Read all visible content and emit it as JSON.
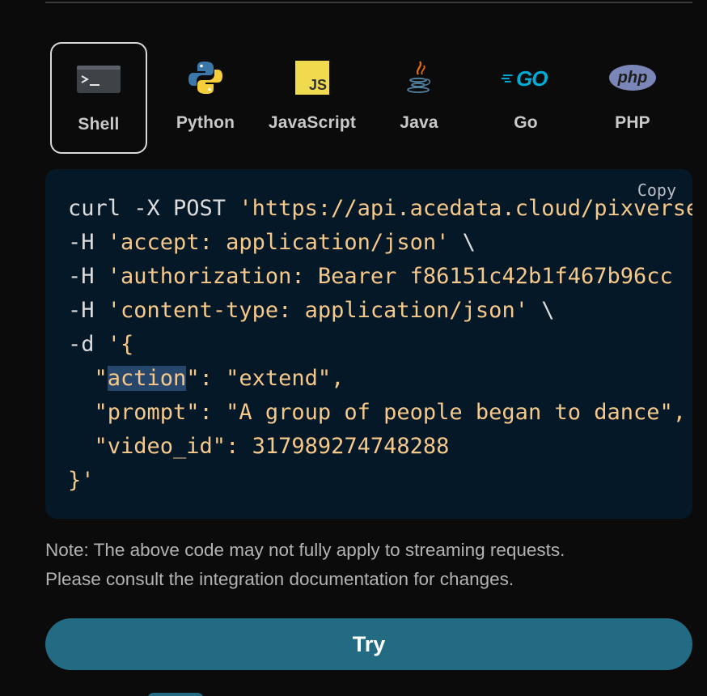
{
  "tabs": [
    {
      "label": "Shell",
      "icon": "terminal-icon",
      "active": true
    },
    {
      "label": "Python",
      "icon": "python-logo-icon",
      "active": false
    },
    {
      "label": "JavaScript",
      "icon": "javascript-logo-icon",
      "active": false
    },
    {
      "label": "Java",
      "icon": "java-logo-icon",
      "active": false
    },
    {
      "label": "Go",
      "icon": "go-logo-icon",
      "active": false
    },
    {
      "label": "PHP",
      "icon": "php-logo-icon",
      "active": false
    }
  ],
  "logos": {
    "js_text": "JS",
    "go_text": "GO",
    "php_text": "php"
  },
  "code": {
    "copy_label": "Copy",
    "l1_cmd": "curl -X POST ",
    "l1_url": "'https://api.acedata.cloud/pixverse/videos'",
    "l1_tail": " \\",
    "l2_flag": "-H ",
    "l2_val": "'accept: application/json'",
    "l2_tail": " \\",
    "l3_flag": "-H ",
    "l3_val": "'authorization: Bearer f86151c42b1f467b96cc",
    "l4_flag": "-H ",
    "l4_val": "'content-type: application/json'",
    "l4_tail": " \\",
    "l5_flag": "-d ",
    "l5_val": "'{",
    "l6_pre": "  \"",
    "l6_key": "action",
    "l6_rest": "\": \"extend\",",
    "l7": "  \"prompt\": \"A group of people began to dance\",",
    "l8": "  \"video_id\": 317989274748288",
    "l9": "}'"
  },
  "note": {
    "line1": "Note: The above code may not fully apply to streaming requests.",
    "line2": "Please consult the integration documentation for changes."
  },
  "try_label": "Try",
  "colors": {
    "background": "#0b0b0b",
    "code_bg": "#051827",
    "string": "#f6c98a",
    "plain": "#dcdcdc",
    "selection": "#27466b",
    "button": "#226b82"
  }
}
